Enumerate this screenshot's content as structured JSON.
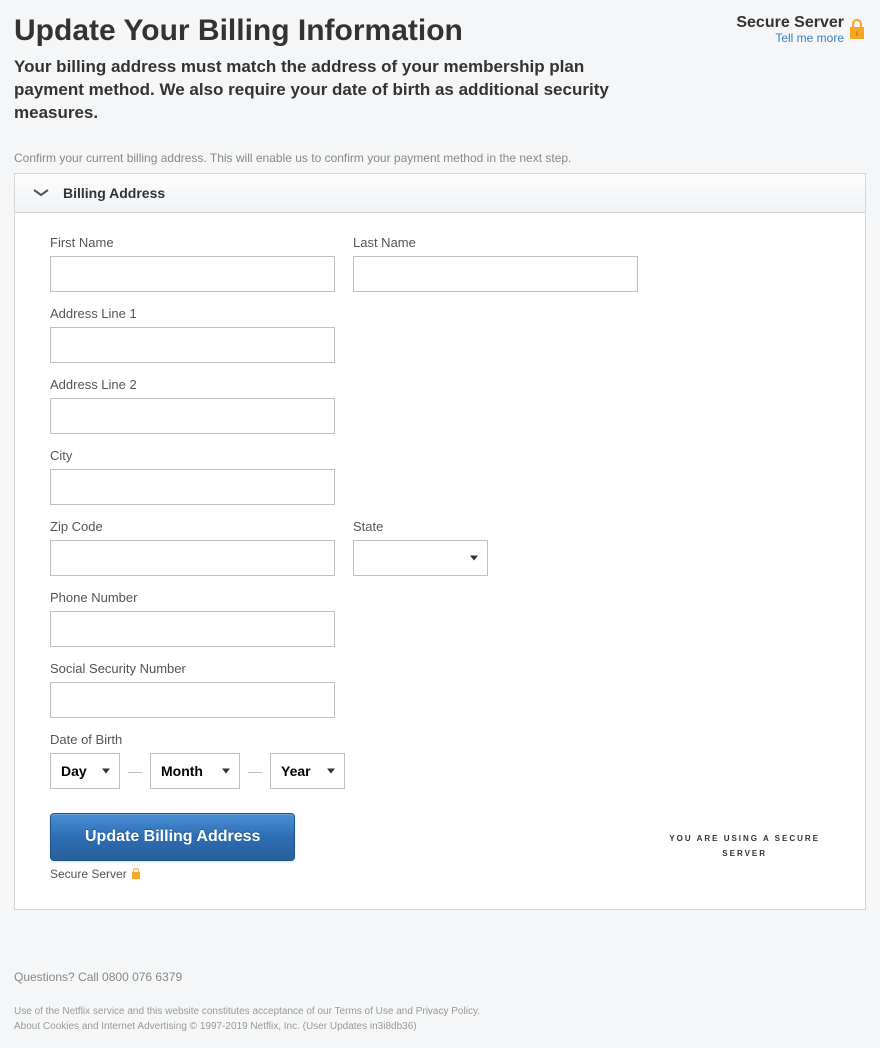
{
  "header": {
    "title": "Update Your Billing Information",
    "secure_server": "Secure Server",
    "tell_me_more": "Tell me more"
  },
  "subtitle": "Your billing address must match the address of your membership plan payment method. We also require your date of birth as additional security measures.",
  "confirm_text": "Confirm your current billing address. This will enable us to confirm your payment method in the next step.",
  "panel": {
    "title": "Billing Address"
  },
  "form": {
    "first_name": {
      "label": "First Name",
      "value": ""
    },
    "last_name": {
      "label": "Last Name",
      "value": ""
    },
    "address1": {
      "label": "Address Line 1",
      "value": ""
    },
    "address2": {
      "label": "Address Line 2",
      "value": ""
    },
    "city": {
      "label": "City",
      "value": ""
    },
    "zip": {
      "label": "Zip Code",
      "value": ""
    },
    "state": {
      "label": "State",
      "value": ""
    },
    "phone": {
      "label": "Phone Number",
      "value": ""
    },
    "ssn": {
      "label": "Social Security Number",
      "value": ""
    },
    "dob": {
      "label": "Date of Birth",
      "day": "Day",
      "month": "Month",
      "year": "Year"
    },
    "submit": "Update Billing Address",
    "secure_note": "Secure Server",
    "secure_badge_line1": "YOU ARE USING A SECURE",
    "secure_badge_line2": "SERVER"
  },
  "footer": {
    "questions": "Questions? Call 0800 076 6379",
    "legal1_pre": "Use of the Netflix service and this website constitutes acceptance of our ",
    "terms": "Terms of Use",
    "and": " and ",
    "privacy": "Privacy Policy",
    "period": ".",
    "about_cookies": "About Cookies and Internet Advertising",
    "copyright": " © 1997-2019 Netflix, Inc. (User Updates in3i8db36)"
  }
}
